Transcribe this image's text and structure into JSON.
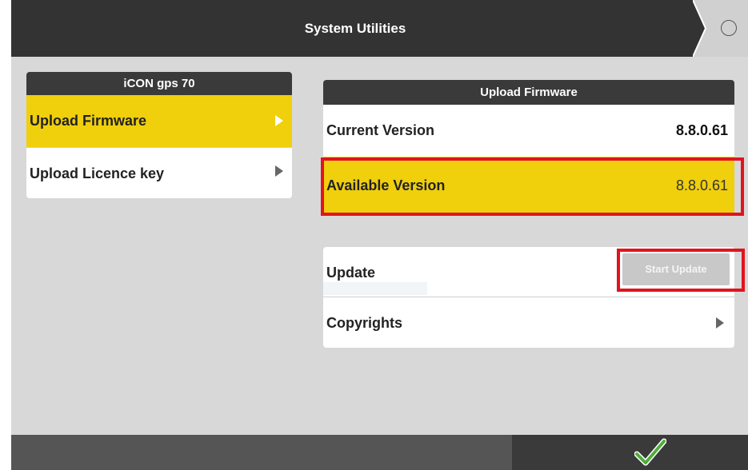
{
  "header": {
    "title": "System Utilities"
  },
  "left_panel": {
    "title": "iCON gps 70",
    "items": [
      {
        "label": "Upload Firmware",
        "selected": true
      },
      {
        "label": "Upload Licence key",
        "selected": false
      }
    ]
  },
  "firmware_panel": {
    "title": "Upload Firmware",
    "current": {
      "label": "Current Version",
      "value": "8.8.0.61"
    },
    "available": {
      "label": "Available Version",
      "value": "8.8.0.61"
    }
  },
  "actions_panel": {
    "update": {
      "label": "Update",
      "button": "Start Update"
    },
    "copyrights": {
      "label": "Copyrights"
    }
  },
  "colors": {
    "accent": "#f0cf0c",
    "highlight": "#e0141e",
    "confirm": "#4fae3a",
    "header": "#333333"
  }
}
